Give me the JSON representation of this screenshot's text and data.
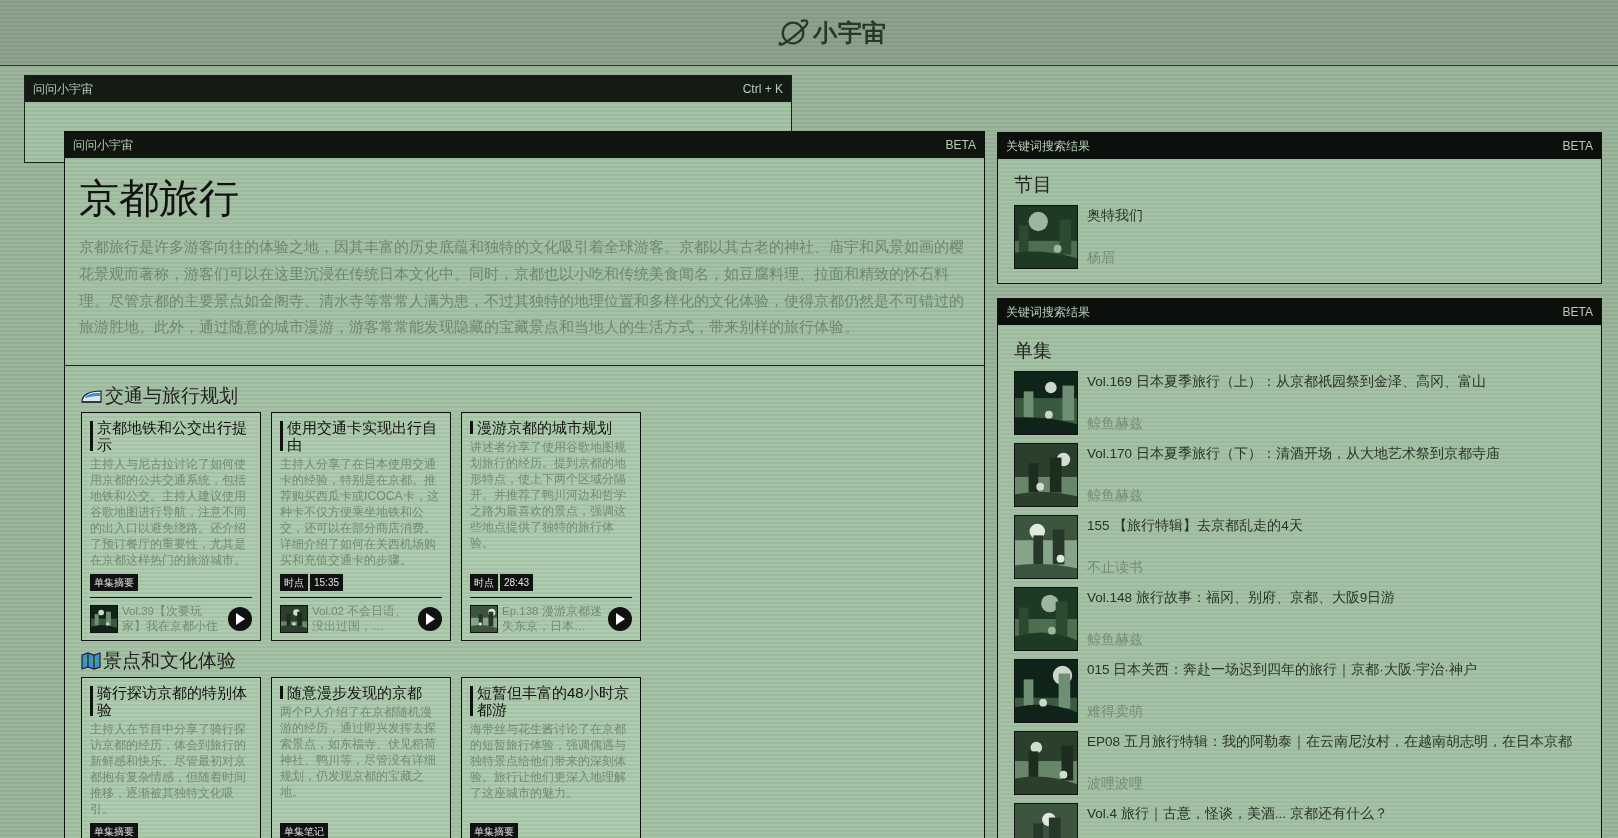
{
  "logo": {
    "text": "小宇宙"
  },
  "search_window": {
    "title": "问问小宇宙",
    "shortcut": "Ctrl + K"
  },
  "main_window": {
    "title": "问问小宇宙",
    "badge": "BETA",
    "heading": "京都旅行",
    "summary": "京都旅行是许多游客向往的体验之地，因其丰富的历史底蕴和独特的文化吸引着全球游客。京都以其古老的神社、庙宇和风景如画的樱花景观而著称，游客们可以在这里沉浸在传统日本文化中。同时，京都也以小吃和传统美食闻名，如豆腐料理、拉面和精致的怀石料理。尽管京都的主要景点如金阁寺、清水寺等常常人满为患，不过其独特的地理位置和多样化的文化体验，使得京都仍然是不可错过的旅游胜地。此外，通过随意的城市漫游，游客常常能发现隐藏的宝藏景点和当地人的生活方式，带来别样的旅行体验。",
    "sections": [
      {
        "title": "交通与旅行规划",
        "cards": [
          {
            "title": "京都地铁和公交出行提示",
            "description": "主持人与尼古拉讨论了如何使用京都的公共交通系统，包括地铁和公交。主持人建议使用谷歌地图进行导航，注意不同的出入口以避免绕路。还介绍了预订餐厅的重要性，尤其是在京都这样热门的旅游城市。",
            "tags": [
              "单集摘要"
            ],
            "episode": {
              "title": "Vol.39【次要玩家】我在京都小住"
            }
          },
          {
            "title": "使用交通卡实现出行自由",
            "description": "主持人分享了在日本使用交通卡的经验，特别是在京都。推荐购买西瓜卡或ICOCA卡，这种卡不仅方便乘坐地铁和公交，还可以在部分商店消费。详细介绍了如何在关西机场购买和充值交通卡的步骤。",
            "tags": [
              "时点",
              "15:35"
            ],
            "episode": {
              "title": "Vol.02 不会日语、没出过国，…"
            }
          },
          {
            "title": "漫游京都的城市规划",
            "description": "讲述者分享了使用谷歌地图规划旅行的经历。提到京都的地形特点，使上下两个区域分隔开。并推荐了鸭川河边和哲学之路为最喜欢的景点，强调这些地点提供了独特的旅行体验。",
            "tags": [
              "时点",
              "28:43"
            ],
            "episode": {
              "title": "Ep.138 漫游京都迷失东京，日本…"
            }
          }
        ]
      },
      {
        "title": "景点和文化体验",
        "cards": [
          {
            "title": "骑行探访京都的特别体验",
            "description": "主持人在节目中分享了骑行探访京都的经历，体会到旅行的新鲜感和快乐。尽管最初对京都抱有复杂情感，但随着时间推移，逐渐被其独特文化吸引。",
            "tags": [
              "单集摘要"
            ]
          },
          {
            "title": "随意漫步发现的京都",
            "description": "两个P人介绍了在京都随机漫游的经历，通过即兴发挥去探索景点，如东福寺、伏见稻荷神社、鸭川等，尽管没有详细规划，仍发现京都的宝藏之地。",
            "tags": [
              "单集笔记"
            ]
          },
          {
            "title": "短暂但丰富的48小时京都游",
            "description": "海带丝与花生酱讨论了在京都的短暂旅行体验，强调偶遇与独特景点给他们带来的深刻体验。旅行让他们更深入地理解了这座城市的魅力。",
            "tags": [
              "单集摘要"
            ]
          }
        ]
      }
    ]
  },
  "panels": [
    {
      "title": "关键词搜索结果",
      "badge": "BETA",
      "heading": "节目",
      "items": [
        {
          "title": "奥特我们",
          "author": "杨眉"
        }
      ]
    },
    {
      "title": "关键词搜索结果",
      "badge": "BETA",
      "heading": "单集",
      "items": [
        {
          "title": "Vol.169 日本夏季旅行（上）：从京都祇园祭到金泽、高冈、富山",
          "author": "鲸鱼赫兹"
        },
        {
          "title": "Vol.170 日本夏季旅行（下）：清酒开场，从大地艺术祭到京都寺庙",
          "author": "鲸鱼赫兹"
        },
        {
          "title": "155 【旅行特辑】去京都乱走的4天",
          "author": "不止读书"
        },
        {
          "title": "Vol.148 旅行故事：福冈、别府、京都、大阪9日游",
          "author": "鲸鱼赫兹"
        },
        {
          "title": "015 日本关西：奔赴一场迟到四年的旅行｜京都·大阪·宇治·神户",
          "author": "难得卖萌"
        },
        {
          "title": "EP08 五月旅行特辑：我的阿勒泰｜在云南尼汝村，在越南胡志明，在日本京都",
          "author": "波哩波哩"
        },
        {
          "title": "Vol.4 旅行｜古意，怪谈，美酒... 京都还有什么？"
        }
      ]
    }
  ]
}
